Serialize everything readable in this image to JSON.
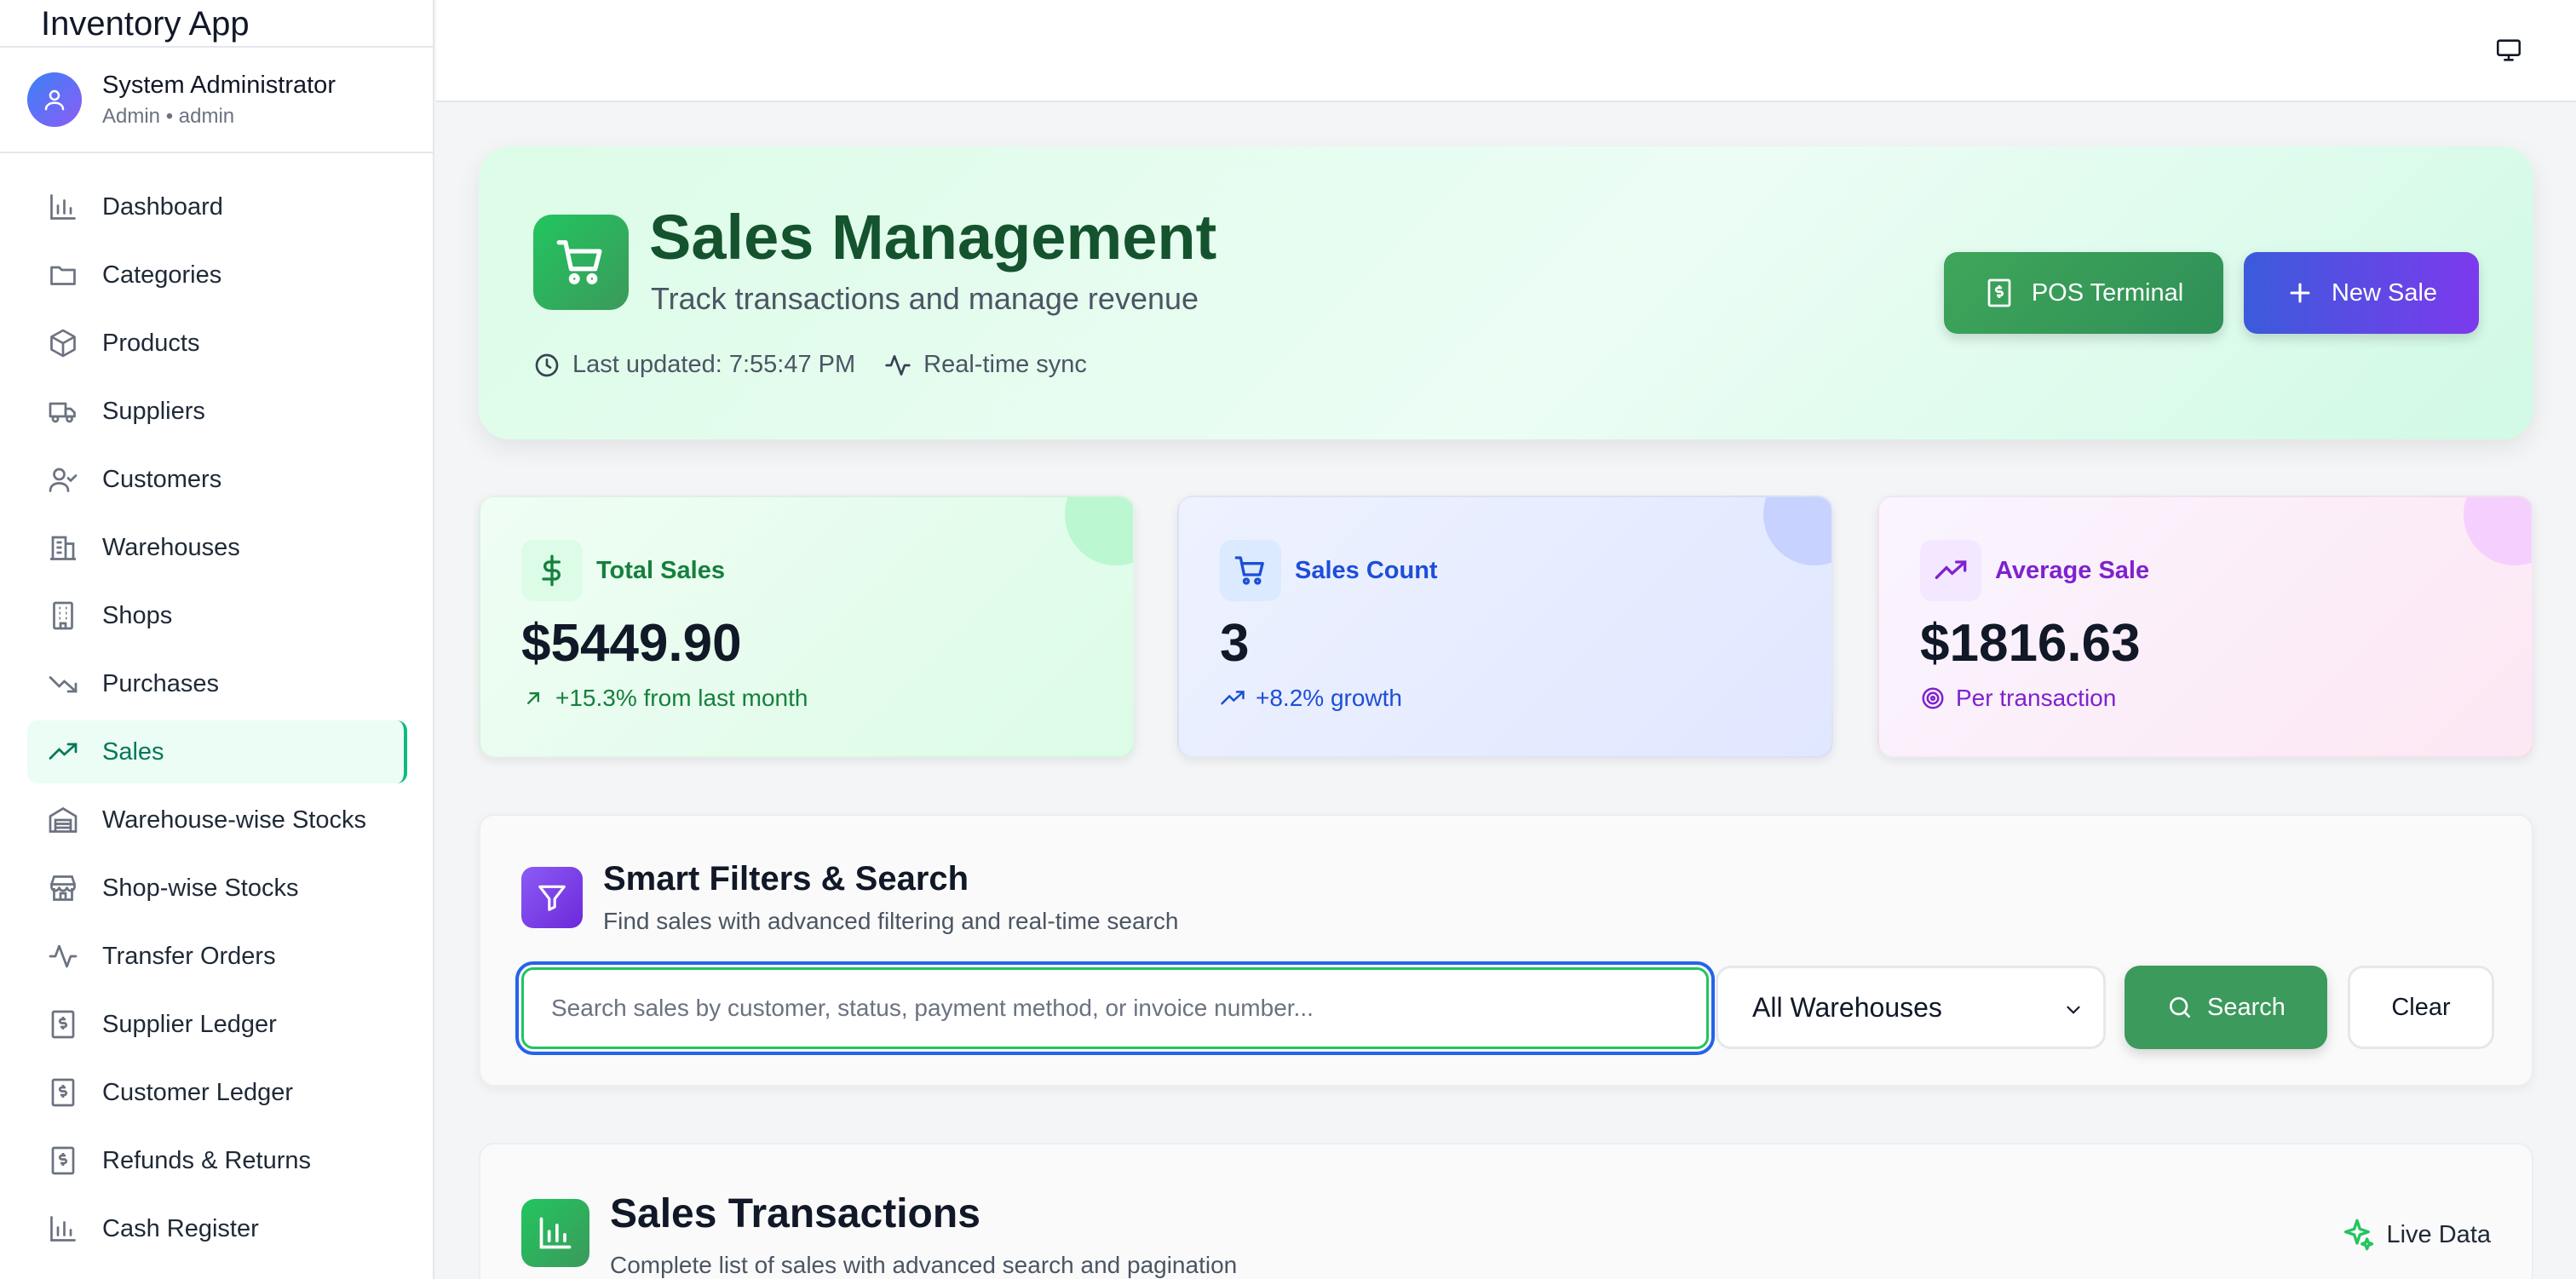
{
  "app": {
    "title": "Inventory App"
  },
  "user": {
    "name": "System Administrator",
    "role": "Admin • admin"
  },
  "sidebar": {
    "items": [
      {
        "label": "Dashboard",
        "icon": "bar-chart-icon"
      },
      {
        "label": "Categories",
        "icon": "folder-icon"
      },
      {
        "label": "Products",
        "icon": "box-icon"
      },
      {
        "label": "Suppliers",
        "icon": "truck-icon"
      },
      {
        "label": "Customers",
        "icon": "user-check-icon"
      },
      {
        "label": "Warehouses",
        "icon": "building-icon"
      },
      {
        "label": "Shops",
        "icon": "store-building-icon"
      },
      {
        "label": "Purchases",
        "icon": "trending-down-icon"
      },
      {
        "label": "Sales",
        "icon": "trending-up-icon",
        "active": true
      },
      {
        "label": "Warehouse-wise Stocks",
        "icon": "warehouse-icon"
      },
      {
        "label": "Shop-wise Stocks",
        "icon": "store-icon"
      },
      {
        "label": "Transfer Orders",
        "icon": "activity-icon"
      },
      {
        "label": "Supplier Ledger",
        "icon": "receipt-icon"
      },
      {
        "label": "Customer Ledger",
        "icon": "receipt-icon"
      },
      {
        "label": "Refunds & Returns",
        "icon": "receipt-icon"
      },
      {
        "label": "Cash Register",
        "icon": "bar-chart-icon"
      }
    ]
  },
  "hero": {
    "title": "Sales Management",
    "subtitle": "Track transactions and manage revenue",
    "last_updated": "Last updated: 7:55:47 PM",
    "sync": "Real-time sync",
    "pos_button": "POS Terminal",
    "new_sale_button": "New Sale"
  },
  "stats": [
    {
      "label": "Total Sales",
      "value": "$5449.90",
      "note": "+15.3% from last month",
      "icon": "dollar-icon"
    },
    {
      "label": "Sales Count",
      "value": "3",
      "note": "+8.2% growth",
      "icon": "cart-icon"
    },
    {
      "label": "Average Sale",
      "value": "$1816.63",
      "note": "Per transaction",
      "icon": "trending-up-icon"
    }
  ],
  "filters": {
    "title": "Smart Filters & Search",
    "subtitle": "Find sales with advanced filtering and real-time search",
    "search_placeholder": "Search sales by customer, status, payment method, or invoice number...",
    "search_value": "",
    "warehouse_selected": "All Warehouses",
    "search_button": "Search",
    "clear_button": "Clear"
  },
  "transactions": {
    "title": "Sales Transactions",
    "subtitle": "Complete list of sales with advanced search and pagination",
    "live": "Live Data"
  },
  "colors": {
    "accent_green": "#3b9a5c",
    "accent_blue": "#3b5bdb",
    "accent_purple": "#7c3aed",
    "active_nav": "#10b981"
  }
}
